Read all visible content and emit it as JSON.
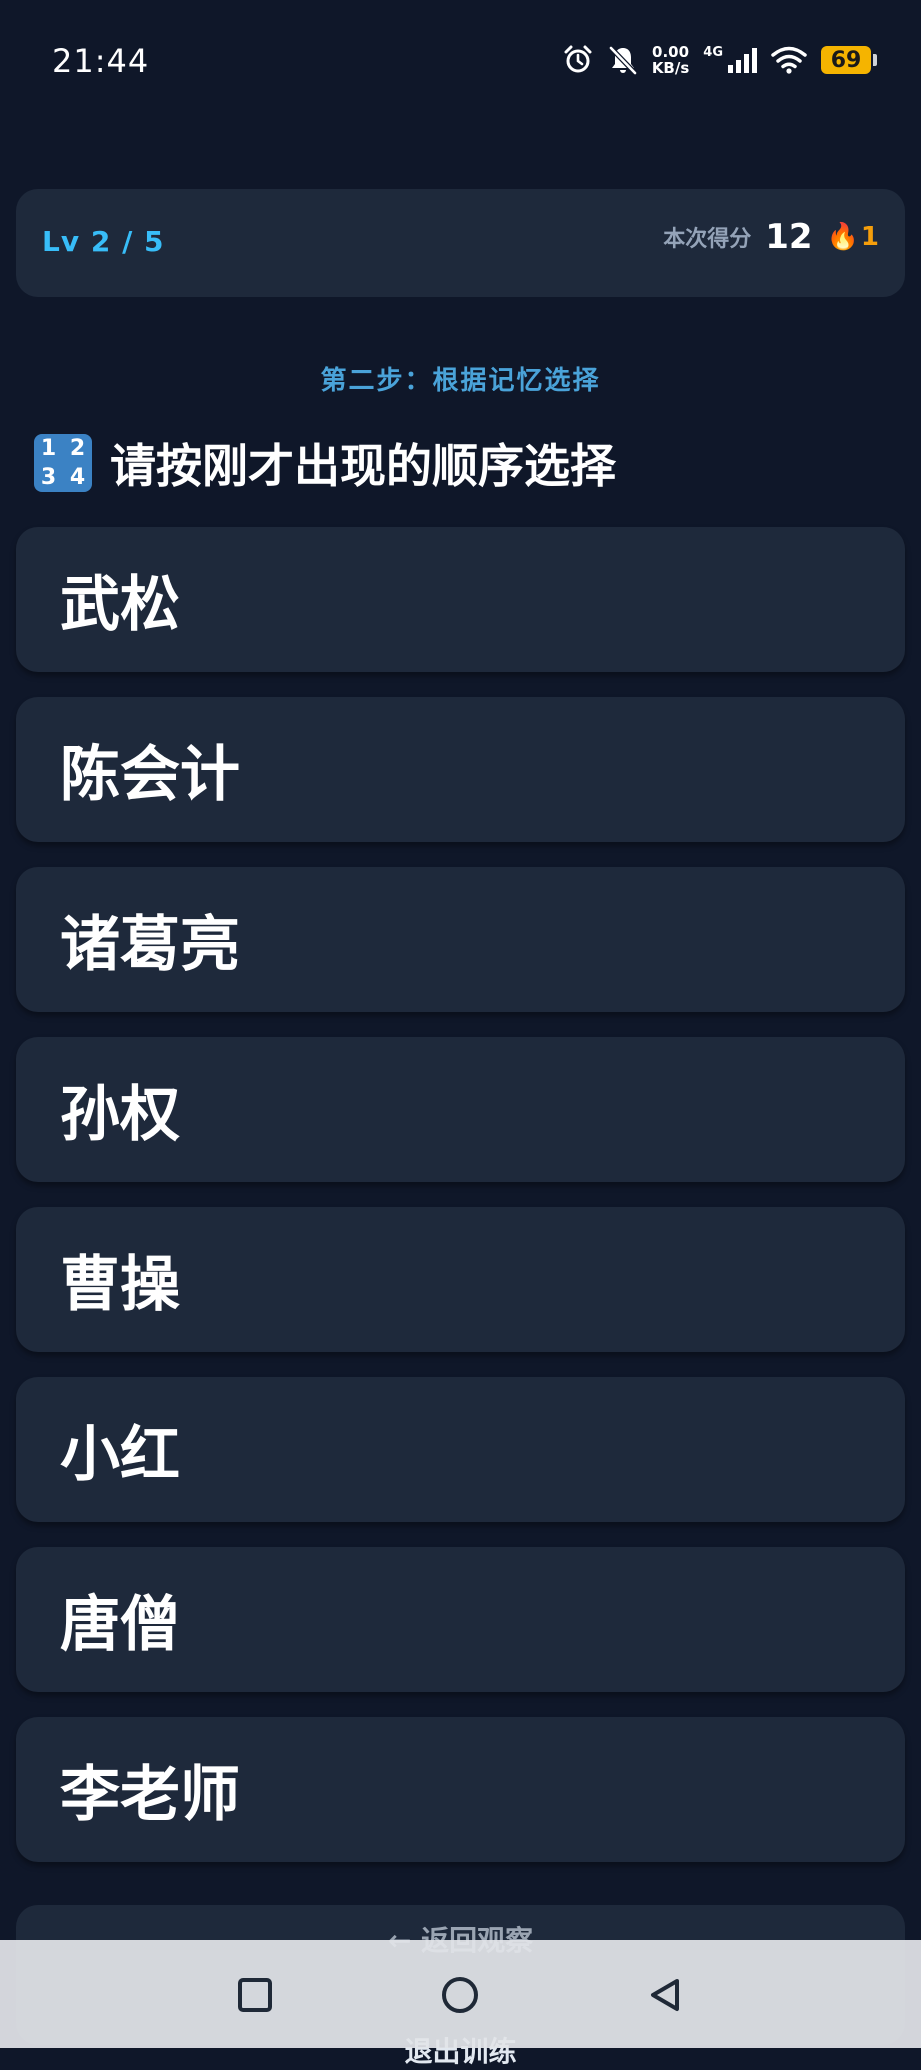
{
  "status_bar": {
    "time": "21:44",
    "net_speed_value": "0.00",
    "net_speed_unit": "KB/s",
    "network_type": "4G",
    "battery_level": "69",
    "icons": [
      "alarm-icon",
      "bell-off-icon",
      "signal-icon",
      "wifi-icon",
      "battery-icon"
    ]
  },
  "header": {
    "level": "Lv 2 / 5",
    "score_label": "本次得分",
    "score_value": "12",
    "streak_icon": "🔥",
    "streak_value": "1"
  },
  "step_label": "第二步：根据记忆选择",
  "question": {
    "icon": "number-keypad-icon",
    "icon_digits": [
      "1",
      "2",
      "3",
      "4"
    ],
    "text": "请按刚才出现的顺序选择"
  },
  "options": [
    "武松",
    "陈会计",
    "诸葛亮",
    "孙权",
    "曹操",
    "小红",
    "唐僧",
    "李老师"
  ],
  "back_button": "← 返回观察",
  "exit_button": "退出训练",
  "colors": {
    "background": "#0f1729",
    "card": "#1e293b",
    "accent": "#38bdf8",
    "step_label": "#4aa3d9",
    "streak": "#f59e0b",
    "battery": "#f5b400"
  }
}
